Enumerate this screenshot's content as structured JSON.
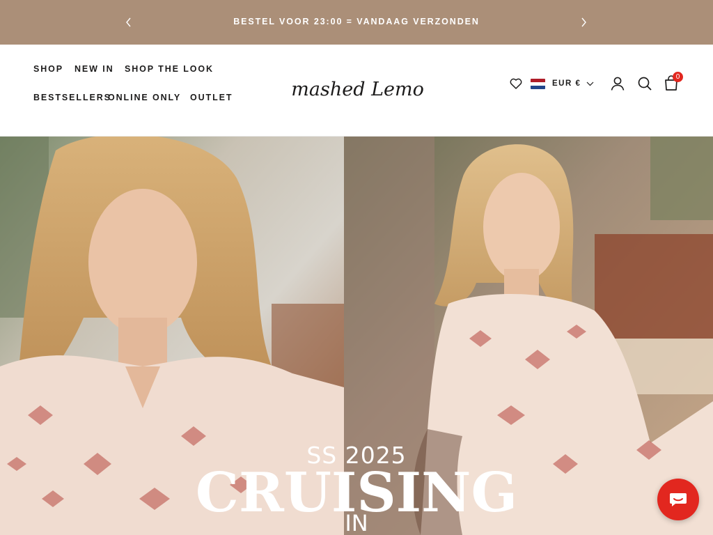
{
  "announcement": {
    "text": "BESTEL VOOR 23:00 = VANDAAG VERZONDEN",
    "background": "#ab8f78"
  },
  "nav": {
    "items": [
      "SHOP",
      "NEW IN",
      "SHOP THE LOOK",
      "BESTSELLERS",
      "ONLINE ONLY",
      "OUTLET"
    ]
  },
  "brand": {
    "logo_text": "Smashed Lemon"
  },
  "header_icons": {
    "wishlist": "heart-icon",
    "flag": "netherlands-flag-icon",
    "currency": "EUR €",
    "account": "user-icon",
    "search": "search-icon",
    "cart": "shopping-bag-icon",
    "cart_count": "0"
  },
  "hero": {
    "subtitle": "SS 2025",
    "title": "CRUISING",
    "line3": "IN"
  },
  "chat": {
    "icon": "chat-bubble-icon",
    "color": "#e2271f"
  }
}
